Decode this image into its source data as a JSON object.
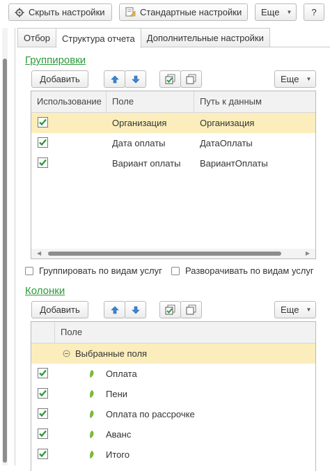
{
  "toolbar": {
    "hide_settings": "Скрыть настройки",
    "standard_settings": "Стандартные настройки",
    "more": "Еще",
    "help": "?"
  },
  "tabs": [
    {
      "label": "Отбор"
    },
    {
      "label": "Структура отчета"
    },
    {
      "label": "Дополнительные настройки"
    }
  ],
  "groupings": {
    "title": "Группировки",
    "add_label": "Добавить",
    "more_label": "Еще",
    "columns": [
      "Использование",
      "Поле",
      "Путь к данным"
    ],
    "rows": [
      {
        "checked": true,
        "field": "Организация",
        "path": "Организация",
        "selected": true
      },
      {
        "checked": true,
        "field": "Дата оплаты",
        "path": "ДатаОплаты",
        "selected": false
      },
      {
        "checked": true,
        "field": "Вариант оплаты",
        "path": "ВариантОплаты",
        "selected": false
      }
    ]
  },
  "options": {
    "group_by_services": "Группировать по видам услуг",
    "expand_by_services": "Разворачивать по видам услуг"
  },
  "columns_section": {
    "title": "Колонки",
    "add_label": "Добавить",
    "more_label": "Еще",
    "header": "Поле",
    "group_row": "Выбранные поля",
    "items": [
      {
        "checked": true,
        "label": "Оплата"
      },
      {
        "checked": true,
        "label": "Пени"
      },
      {
        "checked": true,
        "label": "Оплата по рассрочке"
      },
      {
        "checked": true,
        "label": "Аванс"
      },
      {
        "checked": true,
        "label": "Итого"
      }
    ]
  },
  "colors": {
    "accent_green": "#2d9a3a",
    "selection": "#fbeebc",
    "arrow_blue": "#3a86d6"
  }
}
